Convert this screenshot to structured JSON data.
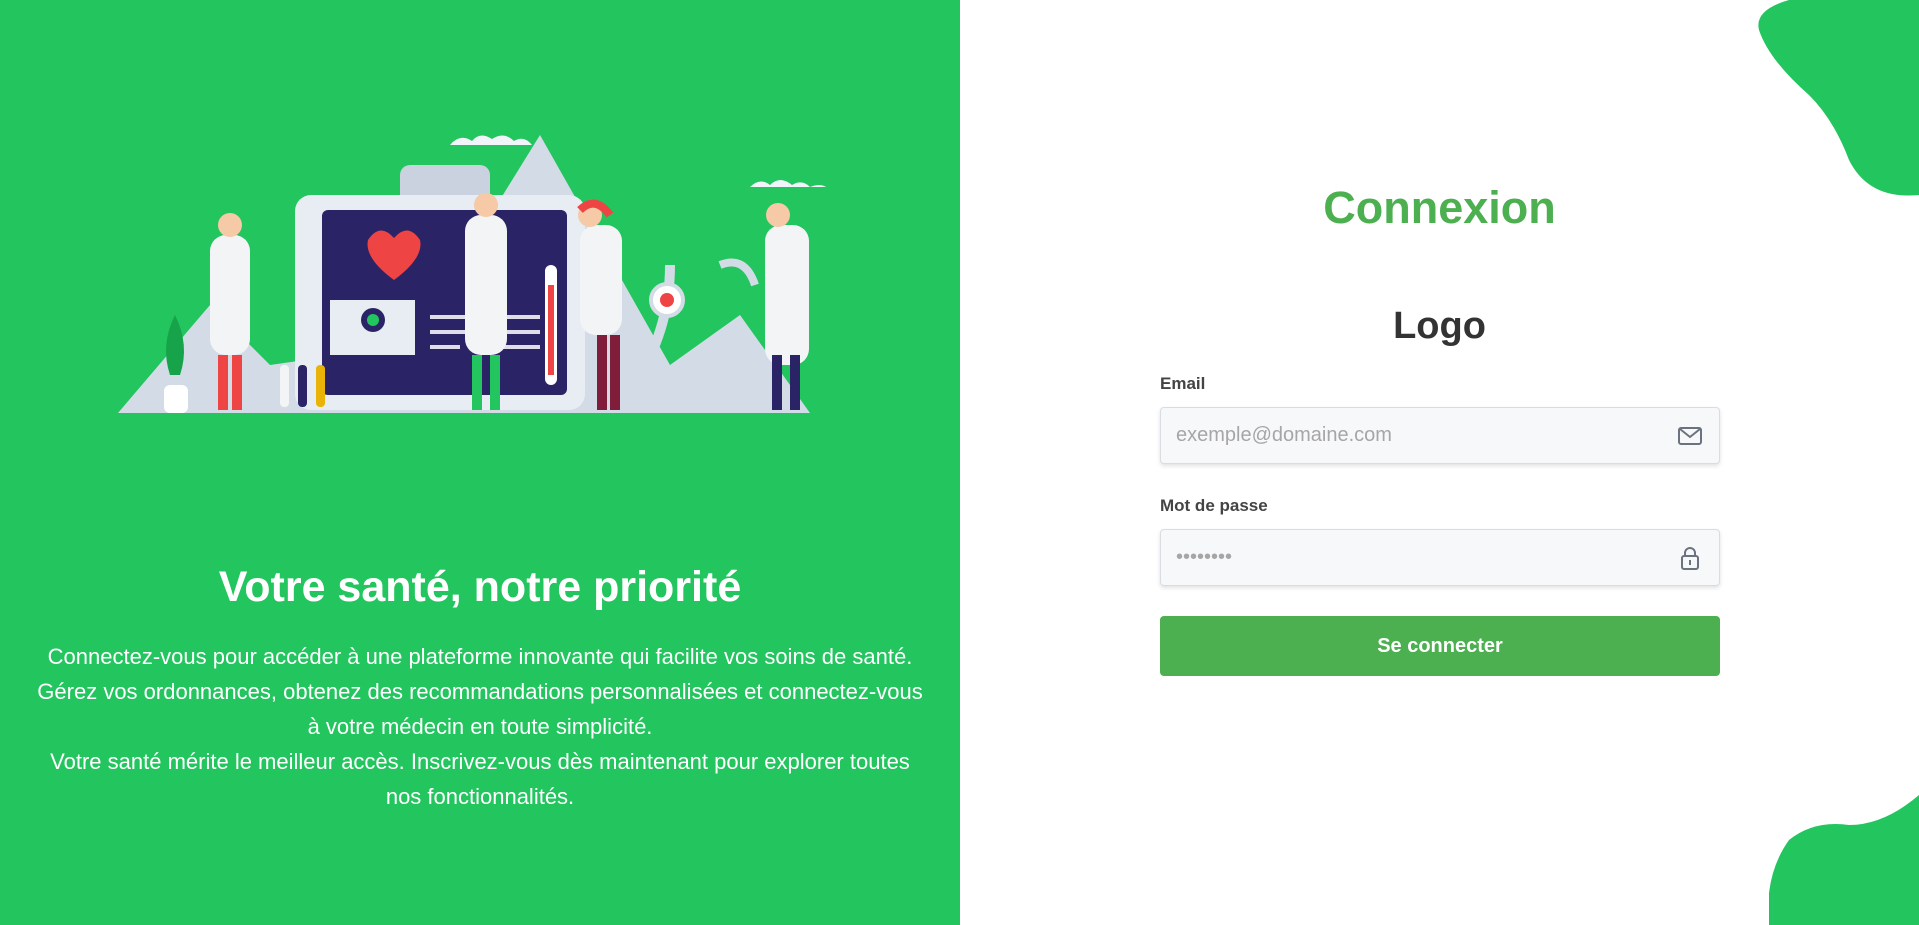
{
  "hero": {
    "headline": "Votre santé, notre priorité",
    "description_lines": [
      "Connectez-vous pour accéder à une plateforme innovante qui facilite vos soins de santé. Gérez vos ordonnances, obtenez des recommandations personnalisées et connectez-vous à votre médecin en toute simplicité.",
      "Votre santé mérite le meilleur accès. Inscrivez-vous dès maintenant pour explorer toutes nos fonctionnalités."
    ]
  },
  "login": {
    "title": "Connexion",
    "logo_text": "Logo",
    "email": {
      "label": "Email",
      "placeholder": "exemple@domaine.com",
      "icon": "envelope-icon"
    },
    "password": {
      "label": "Mot de passe",
      "placeholder": "••••••••",
      "icon": "lock-icon"
    },
    "submit_label": "Se connecter"
  },
  "colors": {
    "left_panel": "#22c55e",
    "accent": "#4caf50",
    "white": "#ffffff"
  }
}
